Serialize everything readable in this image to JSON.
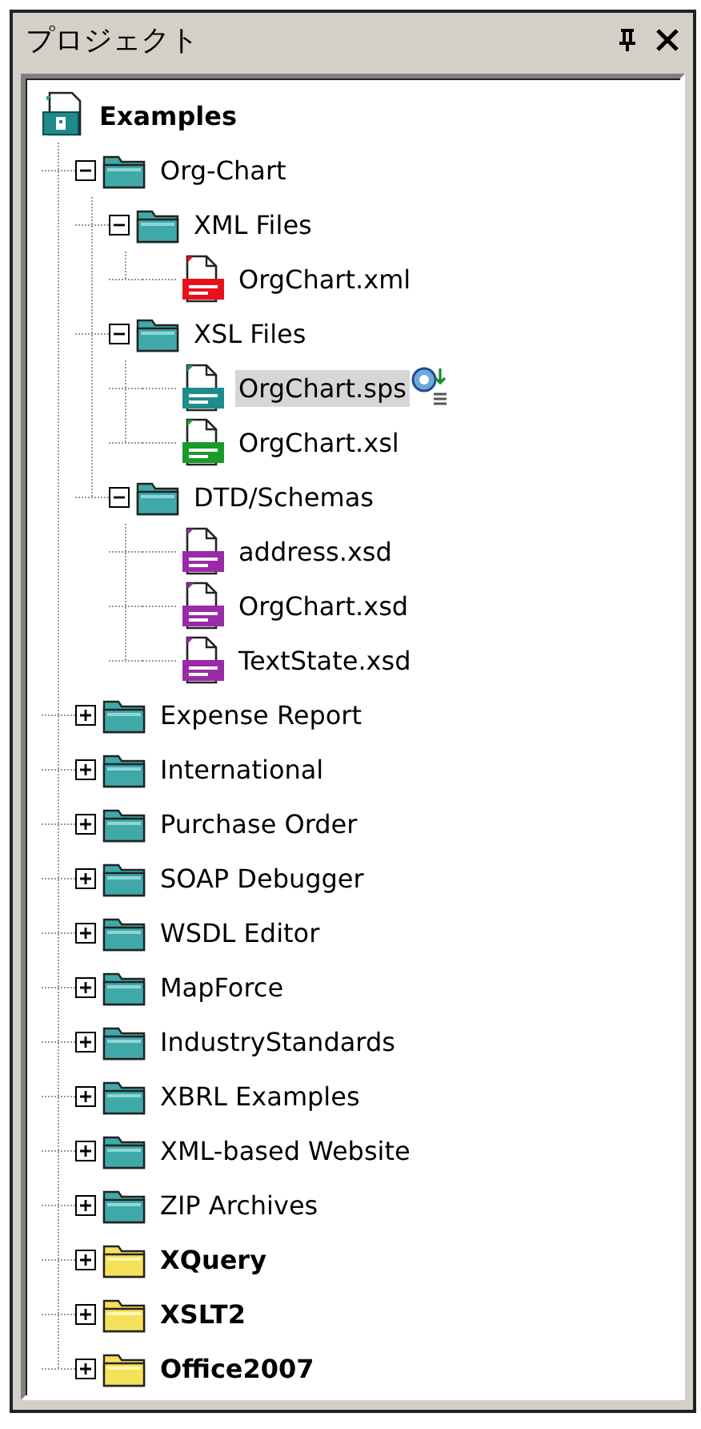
{
  "panel": {
    "title": "プロジェクト"
  },
  "tree": {
    "label": "Examples",
    "kind": "project",
    "selected": false,
    "children": [
      {
        "label": "Org-Chart",
        "kind": "folder",
        "selected": false,
        "expanded": true,
        "children": [
          {
            "label": "XML Files",
            "kind": "folder",
            "selected": false,
            "expanded": true,
            "children": [
              {
                "label": "OrgChart.xml",
                "kind": "xml",
                "selected": false,
                "main_file": false
              }
            ]
          },
          {
            "label": "XSL Files",
            "kind": "folder",
            "selected": false,
            "expanded": true,
            "children": [
              {
                "label": "OrgChart.sps",
                "kind": "sps",
                "selected": true,
                "main_file": true
              },
              {
                "label": "OrgChart.xsl",
                "kind": "xsl",
                "selected": false,
                "main_file": false
              }
            ]
          },
          {
            "label": "DTD/Schemas",
            "kind": "folder",
            "selected": false,
            "expanded": true,
            "children": [
              {
                "label": "address.xsd",
                "kind": "xsd",
                "selected": false,
                "main_file": false
              },
              {
                "label": "OrgChart.xsd",
                "kind": "xsd",
                "selected": false,
                "main_file": false
              },
              {
                "label": "TextState.xsd",
                "kind": "xsd",
                "selected": false,
                "main_file": false
              }
            ]
          }
        ]
      },
      {
        "label": "Expense Report",
        "kind": "folder",
        "selected": false,
        "expanded": false
      },
      {
        "label": "International",
        "kind": "folder",
        "selected": false,
        "expanded": false
      },
      {
        "label": "Purchase Order",
        "kind": "folder",
        "selected": false,
        "expanded": false
      },
      {
        "label": "SOAP Debugger",
        "kind": "folder",
        "selected": false,
        "expanded": false
      },
      {
        "label": "WSDL Editor",
        "kind": "folder",
        "selected": false,
        "expanded": false
      },
      {
        "label": "MapForce",
        "kind": "folder",
        "selected": false,
        "expanded": false
      },
      {
        "label": "IndustryStandards",
        "kind": "folder",
        "selected": false,
        "expanded": false
      },
      {
        "label": "XBRL Examples",
        "kind": "folder",
        "selected": false,
        "expanded": false
      },
      {
        "label": "XML-based Website",
        "kind": "folder",
        "selected": false,
        "expanded": false
      },
      {
        "label": "ZIP Archives",
        "kind": "folder",
        "selected": false,
        "expanded": false
      },
      {
        "label": "XQuery",
        "kind": "external-folder",
        "selected": false,
        "expanded": false
      },
      {
        "label": "XSLT2",
        "kind": "external-folder",
        "selected": false,
        "expanded": false
      },
      {
        "label": "Office2007",
        "kind": "external-folder",
        "selected": false,
        "expanded": false
      }
    ]
  }
}
